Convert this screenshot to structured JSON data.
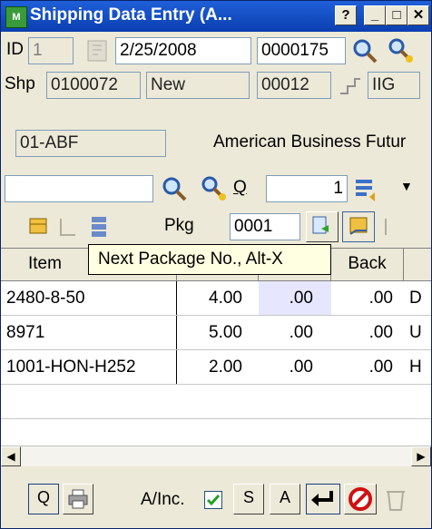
{
  "window": {
    "title": "Shipping Data Entry (A...",
    "help_label": "?",
    "minimize_label": "_",
    "maximize_label": "□",
    "close_label": "✕",
    "app_icon_text": "M"
  },
  "header": {
    "id_label": "ID",
    "id_value": "1",
    "date_value": "2/25/2008",
    "order_no": "0000175",
    "shp_label": "Shp",
    "shipment_no": "0100072",
    "status": "New",
    "code": "00012",
    "code2": "IIG",
    "customer_code": "01-ABF",
    "customer_name": "American Business Futur"
  },
  "item_entry": {
    "q_label": "Q",
    "quantity": "1",
    "pkg_label": "Pkg",
    "pkg_value": "0001"
  },
  "tooltip": {
    "text": "Next Package No., Alt-X"
  },
  "grid": {
    "columns": [
      "Item",
      "d",
      "Back"
    ],
    "rows": [
      {
        "item": "2480-8-50",
        "ordered": "4.00",
        "shipped": ".00",
        "back": ".00",
        "extra": "D"
      },
      {
        "item": "8971",
        "ordered": "5.00",
        "shipped": ".00",
        "back": ".00",
        "extra": "U"
      },
      {
        "item": "1001-HON-H252",
        "ordered": "2.00",
        "shipped": ".00",
        "back": ".00",
        "extra": "H"
      }
    ]
  },
  "footer": {
    "q_button": "Q",
    "ainc_label": "A/Inc.",
    "s_button": "S",
    "a_button": "A"
  }
}
